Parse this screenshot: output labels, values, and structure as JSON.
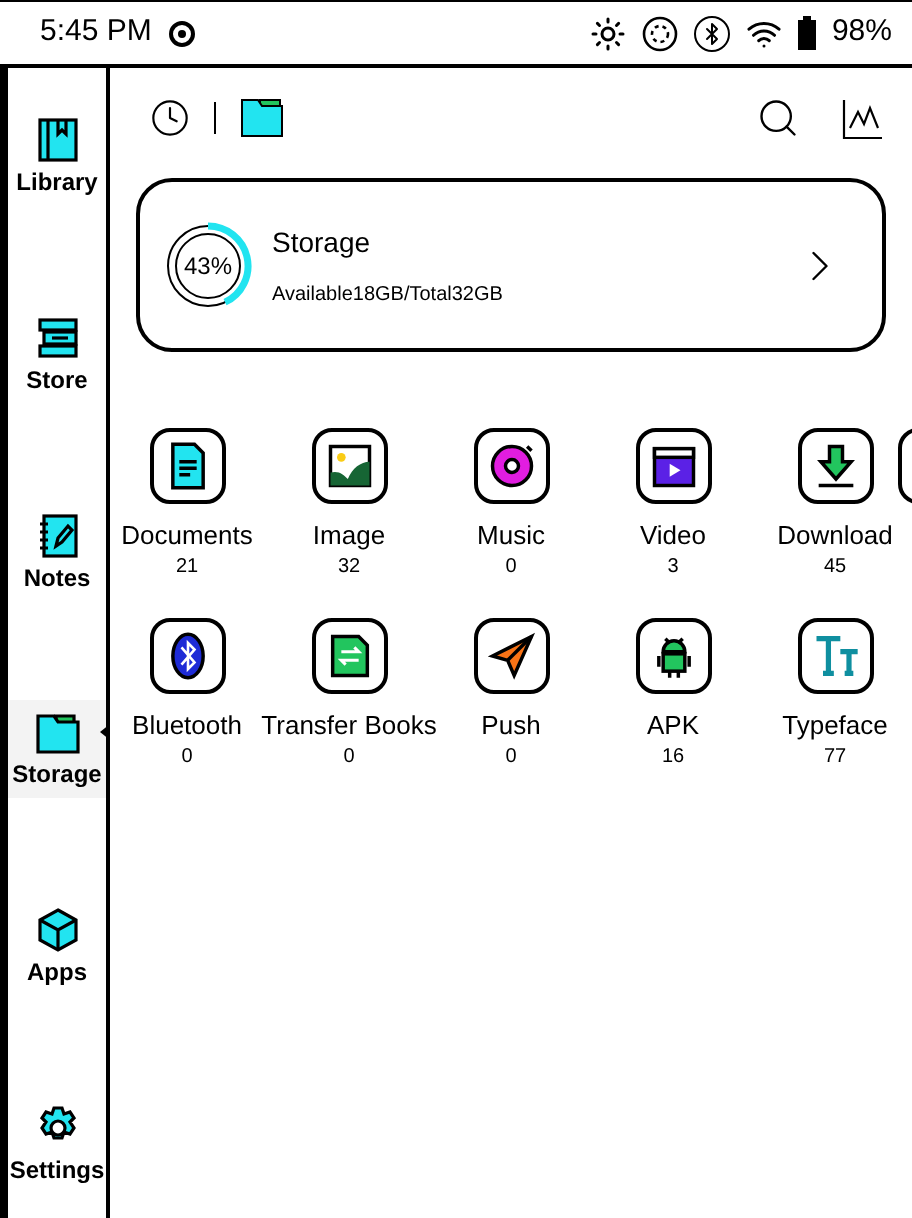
{
  "status_bar": {
    "time": "5:45 PM",
    "battery": "98%"
  },
  "sidebar": {
    "items": [
      {
        "kind": "library",
        "label": "Library",
        "selected": false
      },
      {
        "kind": "store",
        "label": "Store",
        "selected": false
      },
      {
        "kind": "notes",
        "label": "Notes",
        "selected": false
      },
      {
        "kind": "storage",
        "label": "Storage",
        "selected": true
      },
      {
        "kind": "apps",
        "label": "Apps",
        "selected": false
      },
      {
        "kind": "settings",
        "label": "Settings",
        "selected": false
      }
    ]
  },
  "storage_card": {
    "title": "Storage",
    "percent": "43%",
    "level": 0.43,
    "detail": "Available18GB/Total32GB"
  },
  "tiles": [
    {
      "kind": "documents",
      "label": "Documents",
      "count": "21"
    },
    {
      "kind": "image",
      "label": "Image",
      "count": "32"
    },
    {
      "kind": "music",
      "label": "Music",
      "count": "0"
    },
    {
      "kind": "video",
      "label": "Video",
      "count": "3"
    },
    {
      "kind": "download",
      "label": "Download",
      "count": "45"
    },
    {
      "kind": "bluetooth",
      "label": "Bluetooth",
      "count": "0"
    },
    {
      "kind": "transfer",
      "label": "Transfer Books",
      "count": "0"
    },
    {
      "kind": "push",
      "label": "Push",
      "count": "0"
    },
    {
      "kind": "apk",
      "label": "APK",
      "count": "16"
    },
    {
      "kind": "typeface",
      "label": "Typeface",
      "count": "77"
    }
  ]
}
